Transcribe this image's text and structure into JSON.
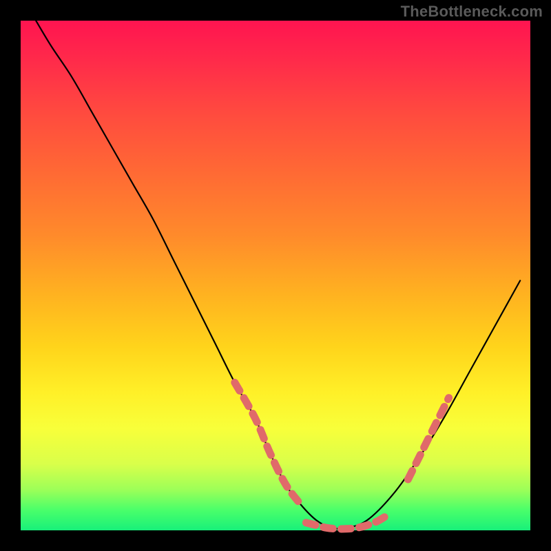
{
  "watermark": "TheBottleneck.com",
  "chart_data": {
    "type": "line",
    "title": "",
    "xlabel": "",
    "ylabel": "",
    "xlim": [
      0,
      100
    ],
    "ylim": [
      0,
      100
    ],
    "series": [
      {
        "name": "bottleneck-curve",
        "style": "solid-black",
        "x": [
          3,
          6,
          10,
          14,
          18,
          22,
          26,
          30,
          34,
          38,
          42,
          46,
          49,
          52,
          55,
          58,
          61,
          64,
          68,
          73,
          78,
          83,
          88,
          93,
          98
        ],
        "y": [
          100,
          95,
          89,
          82,
          75,
          68,
          61,
          53,
          45,
          37,
          29,
          22,
          15,
          9,
          5,
          2,
          0.5,
          0.5,
          2,
          7,
          14,
          22,
          31,
          40,
          49
        ]
      },
      {
        "name": "highlight-left",
        "style": "dashed-coral",
        "x": [
          42,
          46,
          49,
          52,
          55
        ],
        "y": [
          29,
          22,
          15,
          9,
          5
        ]
      },
      {
        "name": "highlight-bottom",
        "style": "dashed-coral",
        "x": [
          56,
          58,
          60,
          62,
          64,
          66,
          68,
          70,
          72
        ],
        "y": [
          1.5,
          1,
          0.5,
          0.3,
          0.3,
          0.5,
          1,
          1.8,
          3
        ]
      },
      {
        "name": "highlight-right",
        "style": "dashed-coral",
        "x": [
          76,
          78,
          80,
          82,
          84
        ],
        "y": [
          10,
          14,
          18,
          22,
          26
        ]
      }
    ],
    "gradient_stops": [
      {
        "pos": 0.0,
        "color": "#ff1450"
      },
      {
        "pos": 0.08,
        "color": "#ff2b4a"
      },
      {
        "pos": 0.18,
        "color": "#ff4a3f"
      },
      {
        "pos": 0.3,
        "color": "#ff6a34"
      },
      {
        "pos": 0.42,
        "color": "#ff8a2b"
      },
      {
        "pos": 0.54,
        "color": "#ffb320"
      },
      {
        "pos": 0.64,
        "color": "#ffd41b"
      },
      {
        "pos": 0.73,
        "color": "#fff028"
      },
      {
        "pos": 0.8,
        "color": "#f8ff3a"
      },
      {
        "pos": 0.87,
        "color": "#d9ff4a"
      },
      {
        "pos": 0.92,
        "color": "#9dff58"
      },
      {
        "pos": 0.96,
        "color": "#4aff6a"
      },
      {
        "pos": 1.0,
        "color": "#18f07a"
      }
    ]
  }
}
